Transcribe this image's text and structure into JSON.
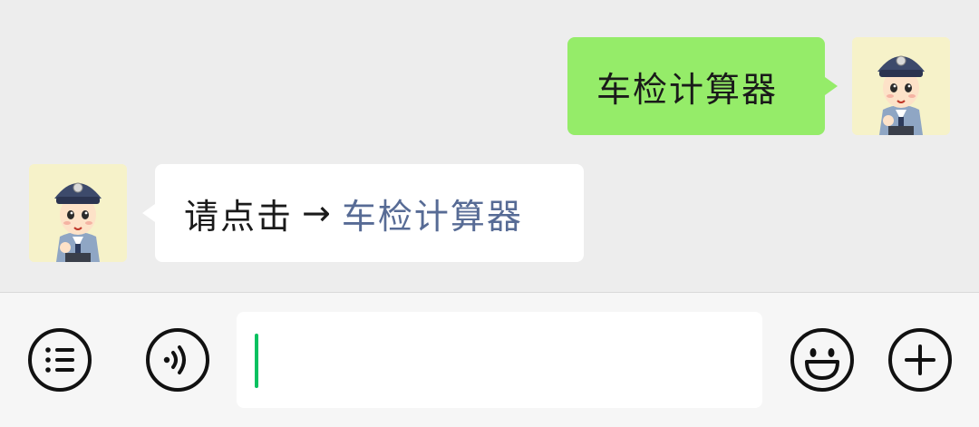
{
  "conversation": {
    "outgoing_message": "车检计算器",
    "incoming_message": {
      "prefix": "请点击",
      "arrow": "→",
      "link_text": "车检计算器"
    }
  },
  "input_bar": {
    "input_value": "",
    "icons": {
      "menu": "list-icon",
      "voice": "voice-icon",
      "emoji": "emoji-icon",
      "more": "plus-icon"
    }
  },
  "colors": {
    "chat_background": "#ededed",
    "outgoing_bubble": "#95ec69",
    "incoming_bubble": "#ffffff",
    "link": "#576b95",
    "cursor": "#07c160"
  }
}
